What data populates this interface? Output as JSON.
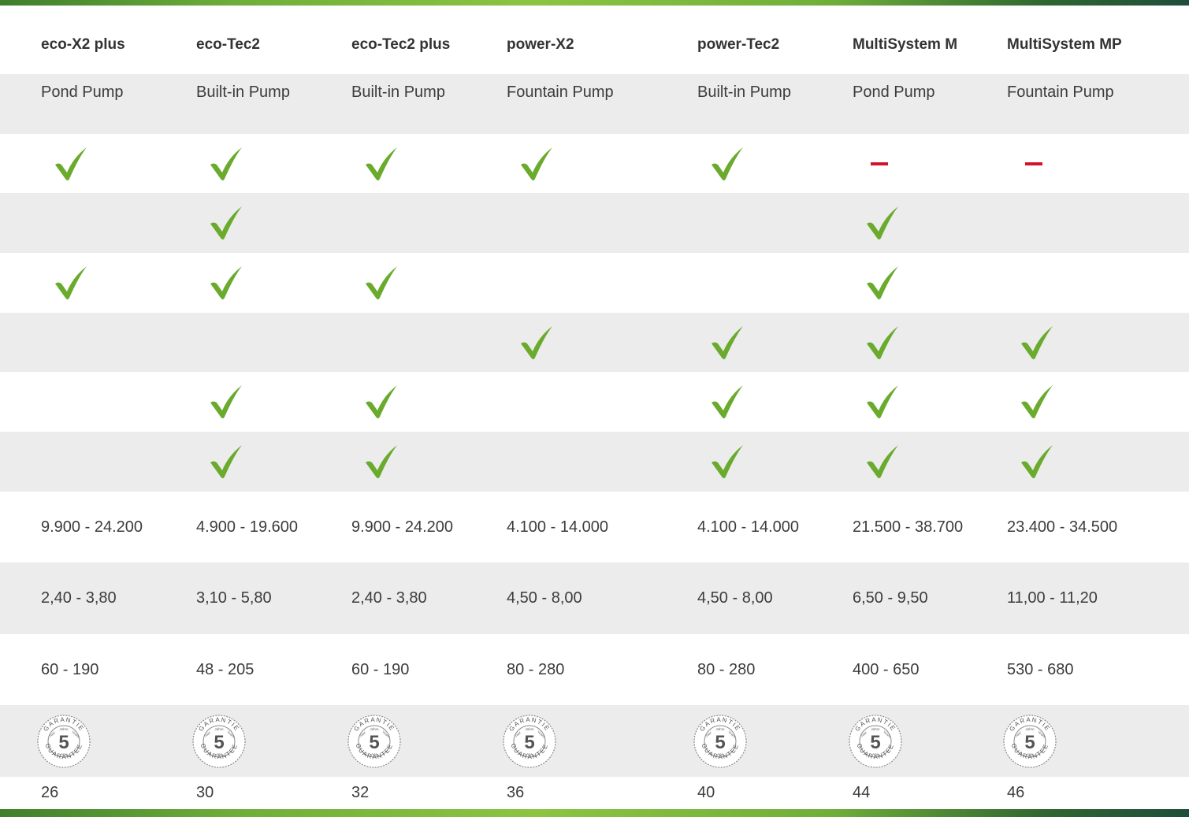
{
  "colors": {
    "accent_green": "#6aaa2c",
    "no_red": "#d2142a",
    "row_gray": "#ebeceb"
  },
  "products": [
    {
      "name": "eco-X2 plus",
      "type": "Pond Pump",
      "features": [
        "check",
        "none",
        "check",
        "none",
        "none",
        "none"
      ],
      "col_a": "9.900 - 24.200",
      "col_b": "2,40 - 3,80",
      "col_c": "60 - 190",
      "page": "26"
    },
    {
      "name": "eco-Tec2",
      "type": "Built-in Pump",
      "features": [
        "check",
        "check",
        "check",
        "none",
        "check",
        "check"
      ],
      "col_a": "4.900 - 19.600",
      "col_b": "3,10 - 5,80",
      "col_c": "48 - 205",
      "page": "30"
    },
    {
      "name": "eco-Tec2 plus",
      "type": "Built-in Pump",
      "features": [
        "check",
        "none",
        "check",
        "none",
        "check",
        "check"
      ],
      "col_a": "9.900 - 24.200",
      "col_b": "2,40 - 3,80",
      "col_c": "60 - 190",
      "page": "32"
    },
    {
      "name": "power-X2",
      "type": "Fountain Pump",
      "features": [
        "check",
        "none",
        "none",
        "check",
        "none",
        "none"
      ],
      "col_a": "4.100 - 14.000",
      "col_b": "4,50 - 8,00",
      "col_c": "80 - 280",
      "page": "36"
    },
    {
      "name": "power-Tec2",
      "type": "Built-in Pump",
      "features": [
        "check",
        "none",
        "none",
        "check",
        "check",
        "check"
      ],
      "col_a": "4.100 - 14.000",
      "col_b": "4,50 - 8,00",
      "col_c": "80 - 280",
      "page": "40"
    },
    {
      "name": "MultiSystem M",
      "type": "Pond Pump",
      "features": [
        "dash",
        "check",
        "check",
        "check",
        "check",
        "check"
      ],
      "col_a": "21.500 - 38.700",
      "col_b": "6,50 - 9,50",
      "col_c": "400 - 650",
      "page": "44"
    },
    {
      "name": "MultiSystem  MP",
      "type": "Fountain Pump",
      "features": [
        "dash",
        "none",
        "none",
        "check",
        "check",
        "check"
      ],
      "col_a": "23.400 - 34.500",
      "col_b": "11,00 - 11,20",
      "col_c": "530 - 680",
      "page": "46"
    }
  ],
  "guarantee_badge": {
    "number": "5",
    "ring_top": "GARANTIE",
    "ring_left": "GARANTIE",
    "ring_right": "GUARANTEE",
    "inner_top": "Jahre",
    "inner_right": "Years",
    "inner_bottom": "Ans",
    "inner_left": "Jaar",
    "icon": "guarantee-5-years-seal-icon"
  }
}
